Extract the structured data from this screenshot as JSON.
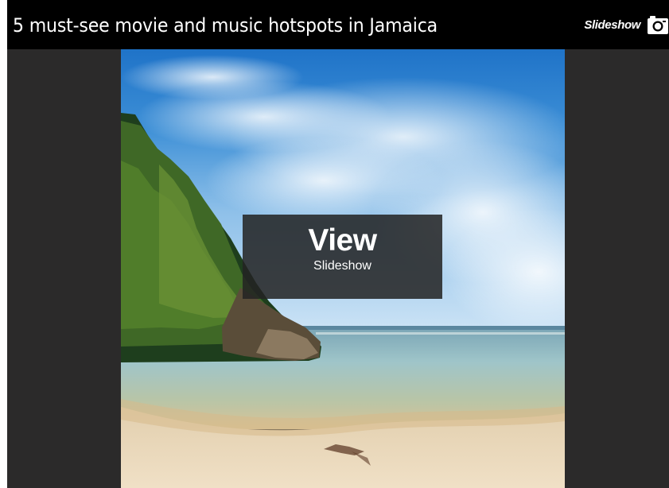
{
  "header": {
    "title": "5 must-see movie and music hotspots in Jamaica",
    "slideshow_label": "Slideshow",
    "slideshow_icon": "camera-icon"
  },
  "photo": {
    "subject": "beach-cove-image"
  },
  "overlay": {
    "main_label": "View",
    "sub_label": "Slideshow"
  },
  "colors": {
    "header_background": "#000000",
    "frame_background": "#2b2a2a",
    "overlay_background": "#232323",
    "text": "#ffffff"
  }
}
